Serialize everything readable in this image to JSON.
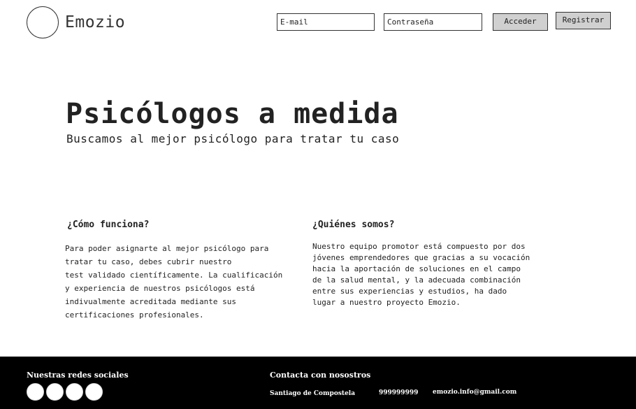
{
  "header": {
    "brand": "Emozio",
    "email_placeholder": "E-mail",
    "password_placeholder": "Contraseña",
    "login_label": "Acceder",
    "register_label": "Registrar"
  },
  "hero": {
    "title": "Psicólogos a medida",
    "subtitle": "Buscamos al mejor psicólogo para tratar tu caso"
  },
  "how": {
    "title": "¿Cómo funciona?",
    "lines": [
      "Para poder asignarte al mejor psicólogo para",
      "tratar tu caso, debes cubrir nuestro",
      "test validado científicamente. La cualificación",
      "y experiencia de nuestros psicólogos está",
      "indivualmente acreditada mediante sus",
      "certificaciones profesionales."
    ]
  },
  "who": {
    "title": "¿Quiénes somos?",
    "lines": [
      "Nuestro equipo promotor está compuesto por dos",
      "jóvenes emprendedores que gracias a su vocación",
      "hacia la aportación de soluciones en el campo",
      "de la salud mental, y la adecuada combinación",
      "entre sus experiencias y estudios, ha dado",
      "lugar a nuestro proyecto Emozio."
    ]
  },
  "footer": {
    "social_title": "Nuestras redes sociales",
    "social_icons": [
      "social-icon-1",
      "social-icon-2",
      "social-icon-3",
      "social-icon-4"
    ],
    "contact_title": "Contacta con nosostros",
    "city": "Santiago de Compostela",
    "phone": "999999999",
    "email": "emozio.info@gmail.com"
  }
}
